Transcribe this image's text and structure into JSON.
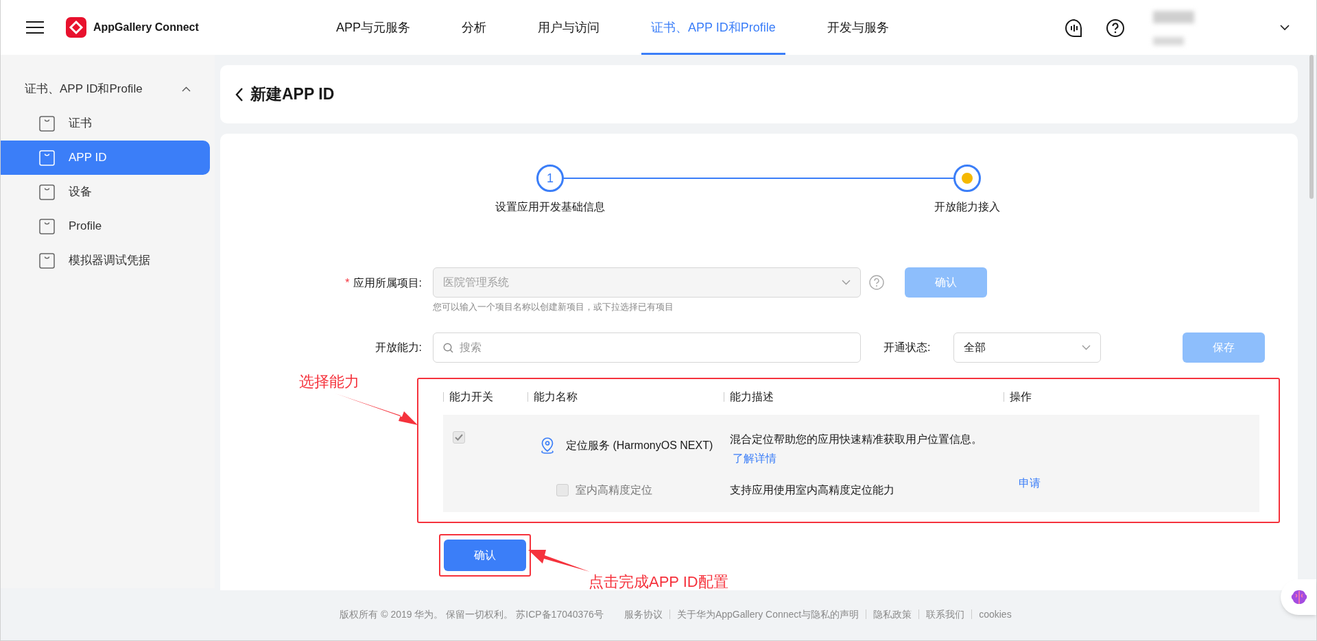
{
  "header": {
    "logo_text": "AppGallery Connect",
    "nav": [
      {
        "label": "APP与元服务",
        "selected": false
      },
      {
        "label": "分析",
        "selected": false
      },
      {
        "label": "用户与访问",
        "selected": false
      },
      {
        "label": "证书、APP ID和Profile",
        "selected": true
      },
      {
        "label": "开发与服务",
        "selected": false
      }
    ]
  },
  "sidebar": {
    "group": {
      "label": "证书、APP ID和Profile",
      "expanded": true
    },
    "items": [
      {
        "label": "证书",
        "selected": false
      },
      {
        "label": "APP ID",
        "selected": true
      },
      {
        "label": "设备",
        "selected": false
      },
      {
        "label": "Profile",
        "selected": false
      },
      {
        "label": "模拟器调试凭据",
        "selected": false
      }
    ]
  },
  "page_title": "新建APP ID",
  "steps": [
    {
      "label": "设置应用开发基础信息",
      "marker": "1",
      "current": false
    },
    {
      "label": "开放能力接入",
      "current": true
    }
  ],
  "form": {
    "project": {
      "label": "应用所属项目:",
      "required_mark": "*",
      "value": "医院管理系统",
      "disabled": true,
      "hint": "您可以输入一个项目名称以创建新项目，或下拉选择已有项目",
      "button": {
        "label": "确认",
        "disabled": true
      }
    },
    "capability": {
      "label": "开放能力:",
      "placeholder": "搜索"
    },
    "status": {
      "label": "开通状态:",
      "value": "全部"
    },
    "save_button": {
      "label": "保存",
      "disabled": true
    }
  },
  "table": {
    "columns": [
      "能力开关",
      "能力名称",
      "能力描述",
      "操作"
    ],
    "rows": [
      {
        "name": "定位服务 (HarmonyOS NEXT)",
        "checked": true,
        "disabled": true,
        "description": "混合定位帮助您的应用快速精准获取用户位置信息。",
        "link": "了解详情",
        "children": [
          {
            "name": "室内高精度定位",
            "checked": false,
            "disabled": true,
            "description": "支持应用使用室内高精度定位能力",
            "action": "申请"
          }
        ]
      }
    ]
  },
  "confirm_button": {
    "label": "确认"
  },
  "annotations": [
    {
      "text": "选择能力"
    },
    {
      "text": "点击完成APP ID配置"
    }
  ],
  "footer": {
    "copyright": "版权所有 © 2019 华为。 保留一切权利。 苏ICP备17040376号",
    "links": [
      "服务协议",
      "关于华为AppGallery Connect与隐私的声明",
      "隐私政策",
      "联系我们",
      "cookies"
    ]
  }
}
